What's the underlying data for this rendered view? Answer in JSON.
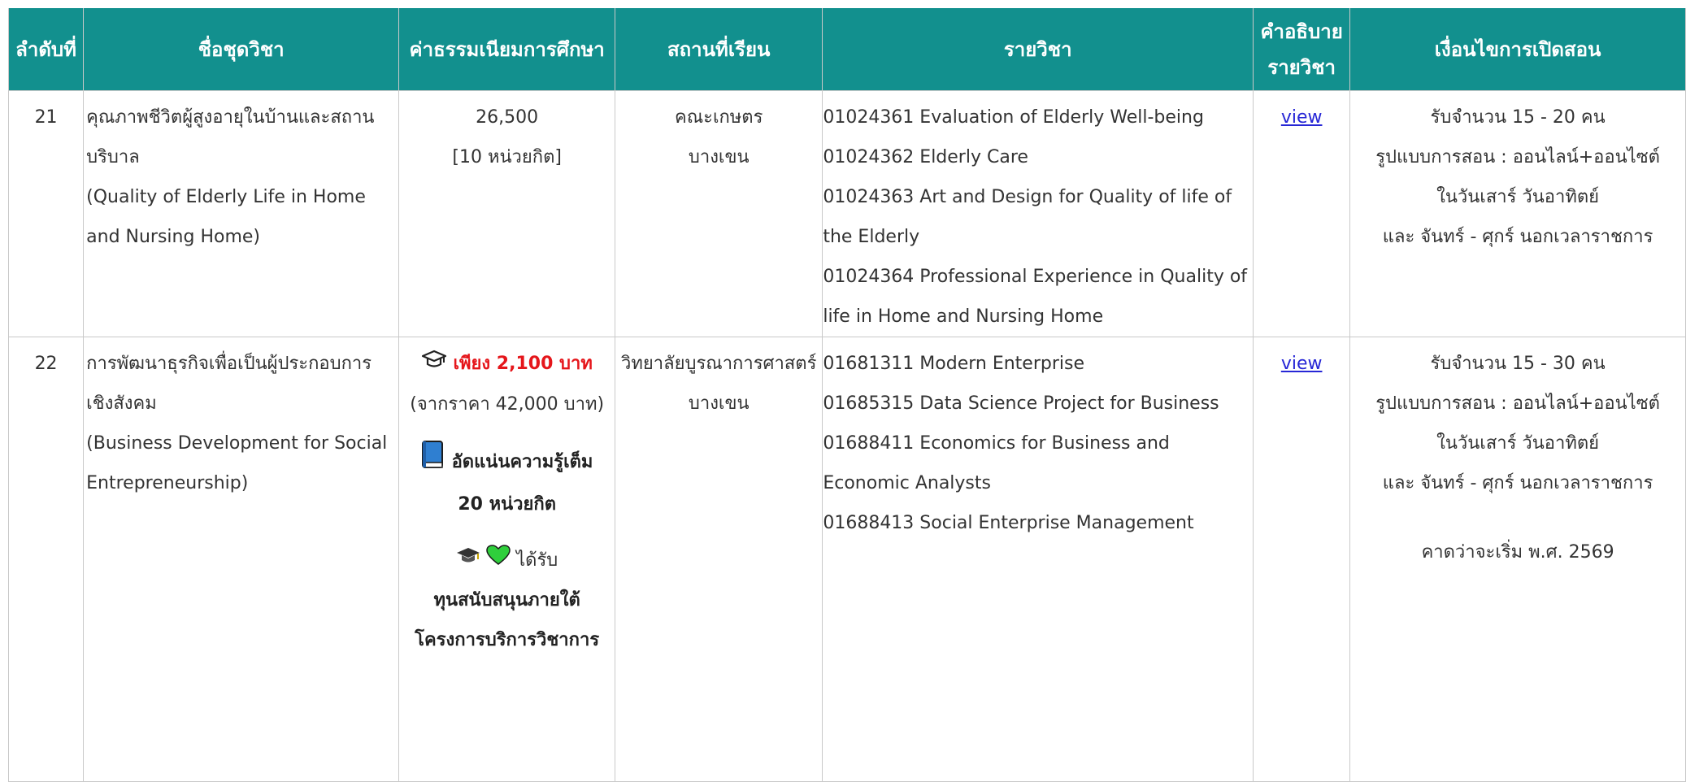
{
  "headers": [
    "ลำดับที่",
    "ชื่อชุดวิชา",
    "ค่าธรรมเนียมการศึกษา",
    "สถานที่เรียน",
    "รายวิชา",
    "คำอธิบาย\nรายวิชา",
    "เงื่อนไขการเปิดสอน"
  ],
  "headers_desc_lines": [
    "คำอธิบาย",
    "รายวิชา"
  ],
  "rows": [
    {
      "no": "21",
      "name_lines": [
        "คุณภาพชีวิตผู้สูงอายุในบ้านและสถาน",
        "บริบาล",
        "(Quality of Elderly Life in Home",
        "and Nursing Home)"
      ],
      "fee": "26,500",
      "credits": "[10 หน่วยกิต]",
      "place_lines": [
        "คณะเกษตร",
        "บางเขน"
      ],
      "courses": [
        "01024361 Evaluation of Elderly Well-being",
        "01024362 Elderly Care",
        "01024363 Art and Design for Quality of life of",
        "the Elderly",
        "01024364 Professional Experience in Quality of",
        "life in Home and Nursing Home"
      ],
      "view": "view",
      "conditions": [
        "รับจำนวน 15 - 20 คน",
        "รูปแบบการสอน : ออนไลน์+ออนไซต์",
        "ในวันเสาร์ วันอาทิตย์",
        "และ จันทร์ - ศุกร์ นอกเวลาราชการ"
      ]
    },
    {
      "no": "22",
      "name_lines": [
        "การพัฒนาธุรกิจเพื่อเป็นผู้ประกอบการ",
        "เชิงสังคม",
        "(Business Development for Social",
        "Entrepreneurship)"
      ],
      "fee_promo": "เพียง 2,100 บาท",
      "fee_original": "(จากราคา 42,000 บาท)",
      "credits_lines": [
        "อัดแน่นความรู้เต็ม",
        "20 หน่วยกิต"
      ],
      "scholar_prefix": "ได้รับ",
      "scholar_lines": [
        "ทุนสนับสนุนภายใต้",
        "โครงการบริการวิชาการ"
      ],
      "place_lines": [
        "วิทยาลัยบูรณาการศาสตร์",
        "บางเขน"
      ],
      "courses": [
        "01681311 Modern Enterprise",
        "01685315 Data Science Project for Business",
        "01688411 Economics for Business and",
        "Economic Analysts",
        "01688413 Social Enterprise Management"
      ],
      "view": "view",
      "conditions": [
        "รับจำนวน 15 - 30 คน",
        "รูปแบบการสอน : ออนไลน์+ออนไซต์",
        "ในวันเสาร์ วันอาทิตย์",
        "และ จันทร์ - ศุกร์ นอกเวลาราชการ"
      ],
      "start_note": "คาดว่าจะเริ่ม พ.ศ. 2569"
    }
  ],
  "icons": [
    "graduation-cap-outline-icon",
    "blue-book-icon",
    "graduation-cap-icon",
    "green-heart-icon"
  ],
  "colors": {
    "header_bg": "#12908e",
    "promo_red": "#e5161b",
    "link": "#2727d6"
  }
}
